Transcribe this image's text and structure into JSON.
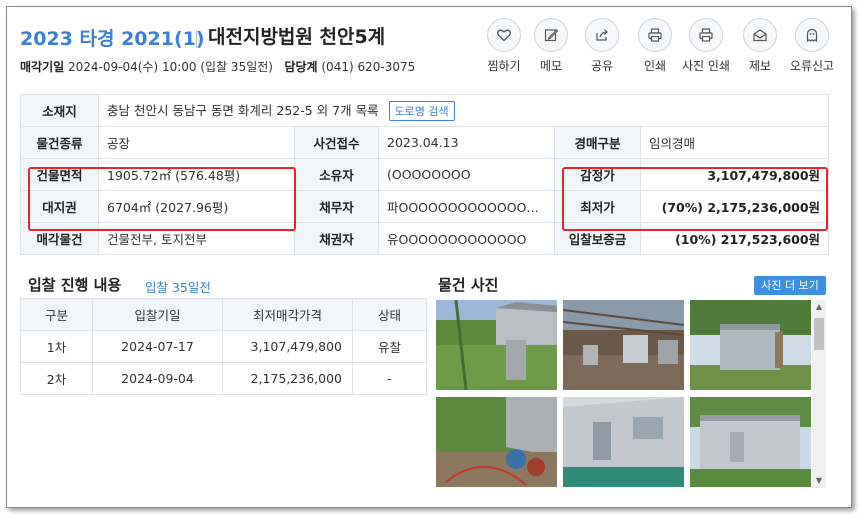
{
  "header": {
    "case_number": "2023 타경 2021(1)",
    "court": "대전지방법원 천안5계",
    "sale_date_label": "매각기일",
    "sale_date_value": "2024-09-04(수) 10:00 (입찰 35일전)",
    "dept_label": "담당계",
    "dept_phone": "(041) 620-3075"
  },
  "actions": [
    {
      "label": "찜하기",
      "icon": "heart-icon"
    },
    {
      "label": "메모",
      "icon": "memo-icon"
    },
    {
      "label": "공유",
      "icon": "share-icon"
    },
    {
      "label": "인쇄",
      "icon": "printer-icon"
    },
    {
      "label": "사진 인쇄",
      "icon": "photo-print-icon"
    },
    {
      "label": "제보",
      "icon": "report-envelope-icon"
    },
    {
      "label": "오류신고",
      "icon": "ghost-icon"
    }
  ],
  "info": {
    "address_label": "소재지",
    "address_value": "충남 천안시 동남구 동면 화계리 252-5 외 7개 목록",
    "road_search": "도로명 검색",
    "type_label": "물건종류",
    "type_value": "공장",
    "receipt_label": "사건접수",
    "receipt_value": "2023.04.13",
    "auction_kind_label": "경매구분",
    "auction_kind_value": "임의경매",
    "building_area_label": "건물면적",
    "building_area_value": "1905.72㎡ (576.48평)",
    "owner_label": "소유자",
    "owner_value": "(OOOOOOOO",
    "appraisal_label": "감정가",
    "appraisal_value": "3,107,479,800원",
    "land_right_label": "대지권",
    "land_right_value": "6704㎡ (2027.96평)",
    "debtor_label": "채무자",
    "debtor_value": "파OOOOOOOOOOOOOOOO...",
    "min_price_label": "최저가",
    "min_price_value": "(70%) 2,175,236,000원",
    "sale_object_label": "매각물건",
    "sale_object_value": "건물전부, 토지전부",
    "creditor_label": "채권자",
    "creditor_value": "유OOOOOOOOOOOOO",
    "deposit_label": "입찰보증금",
    "deposit_value": "(10%) 217,523,600원"
  },
  "bids": {
    "title": "입찰 진행 내용",
    "subtitle": "입찰 35일전",
    "columns": [
      "구분",
      "입찰기일",
      "최저매각가격",
      "상태"
    ],
    "rows": [
      [
        "1차",
        "2024-07-17",
        "3,107,479,800",
        "유찰"
      ],
      [
        "2차",
        "2024-09-04",
        "2,175,236,000",
        "-"
      ]
    ]
  },
  "photos": {
    "title": "물건 사진",
    "more_button": "사진 더 보기"
  },
  "colors": {
    "accent": "#3d7fd6",
    "highlight_box": "#e8242b",
    "header_cell_bg": "#f3f6f9"
  }
}
